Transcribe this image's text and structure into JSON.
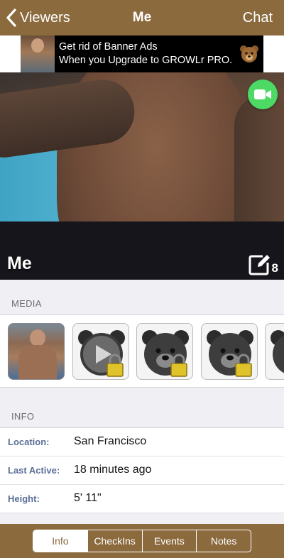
{
  "navbar": {
    "back_label": "Viewers",
    "title": "Me",
    "chat_label": "Chat",
    "color": "#8b6a3e"
  },
  "banner": {
    "line1": "Get rid of Banner Ads",
    "line2": "When you Upgrade to GROWLr PRO."
  },
  "profile": {
    "name": "Me",
    "photo_count": "8"
  },
  "media": {
    "header": "MEDIA",
    "items": [
      "photo",
      "locked-video",
      "locked-photo",
      "locked-photo",
      "locked-photo"
    ]
  },
  "info": {
    "header": "INFO",
    "rows": [
      {
        "label": "Location:",
        "value": "San Francisco"
      },
      {
        "label": "Last Active:",
        "value": "18 minutes ago"
      },
      {
        "label": "Height:",
        "value": "5' 11\""
      }
    ]
  },
  "tabs": {
    "items": [
      "Info",
      "CheckIns",
      "Events",
      "Notes"
    ],
    "active": "Info"
  },
  "colors": {
    "brand": "#8b6a3e",
    "video_button": "#4cd964",
    "label_blue": "#5b6f98"
  }
}
